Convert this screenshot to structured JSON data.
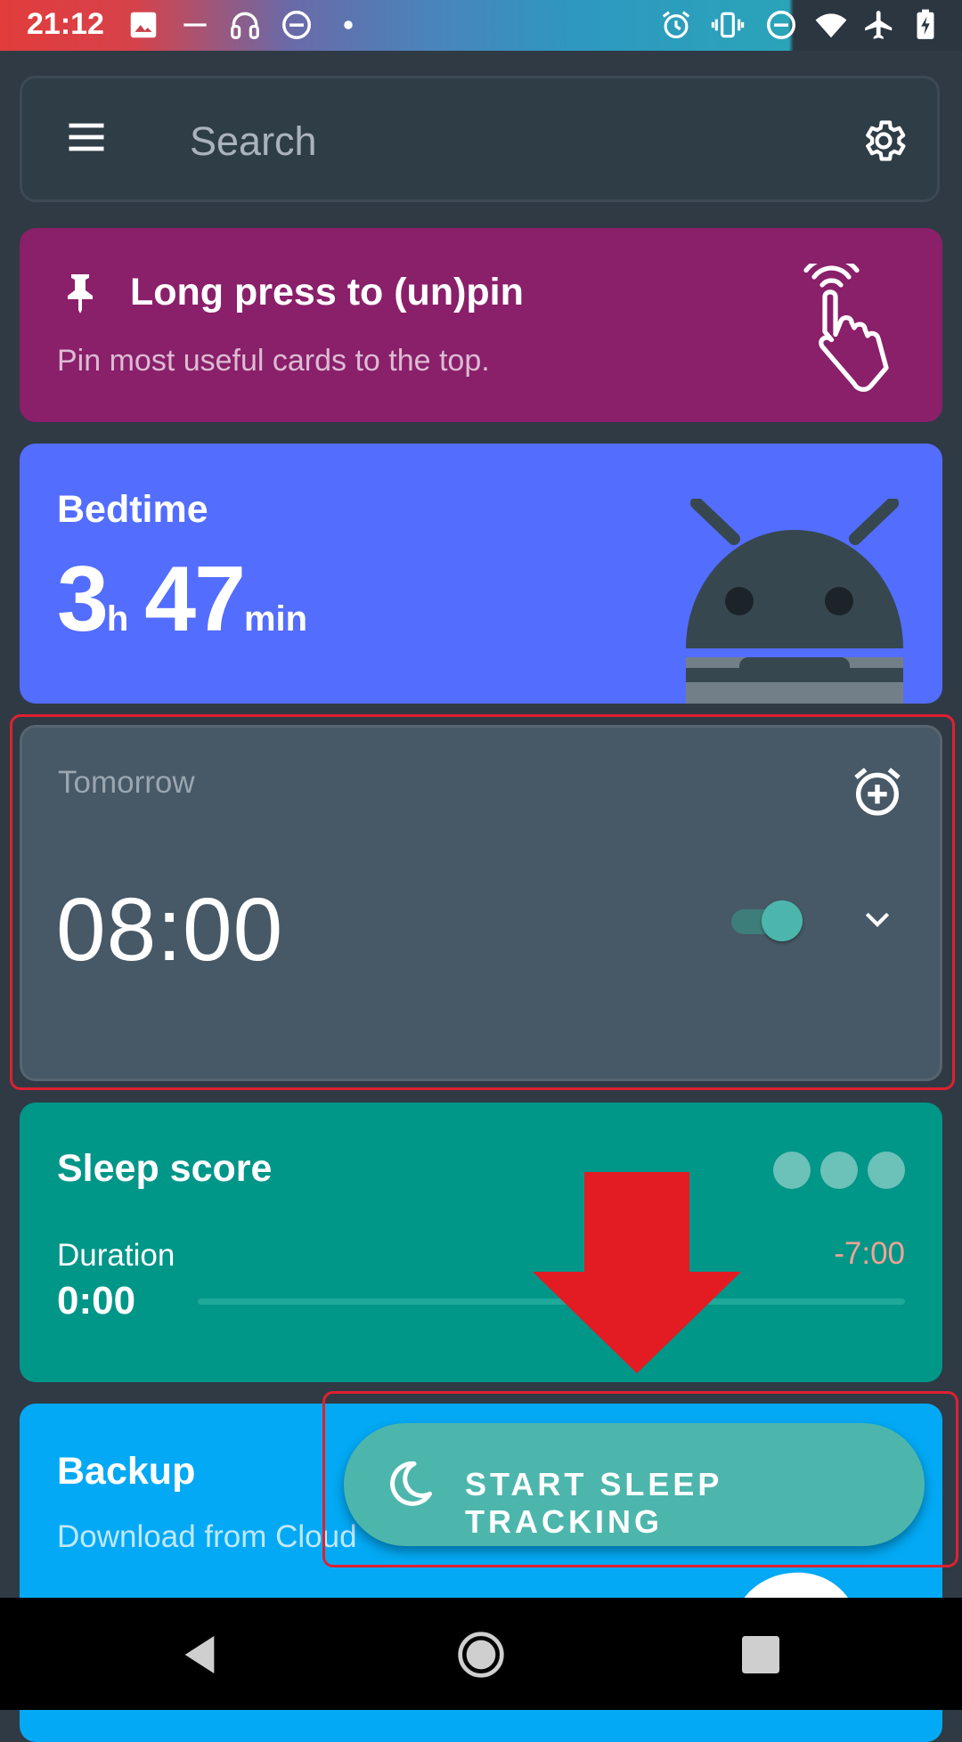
{
  "status_bar": {
    "time": "21:12",
    "left_icons": [
      "image-icon",
      "dash-icon",
      "headphones-icon",
      "dnd-icon",
      "dot-icon"
    ],
    "right_icons": [
      "alarm-icon",
      "vibrate-icon",
      "dnd-icon",
      "wifi-icon",
      "airplane-icon",
      "battery-charging-icon"
    ]
  },
  "search": {
    "placeholder": "Search",
    "menu_icon": "menu-icon",
    "settings_icon": "gear-icon"
  },
  "pin_card": {
    "title": "Long press to (un)pin",
    "subtitle": "Pin most useful cards to the top.",
    "icons": [
      "pin-icon",
      "touch-hand-icon"
    ],
    "color": "#8a1f6a"
  },
  "bedtime_card": {
    "label": "Bedtime",
    "hours": "3",
    "hours_unit": "h",
    "minutes": "47",
    "minutes_unit": "min",
    "color": "#536dfe"
  },
  "alarm_card": {
    "day": "Tomorrow",
    "time": "08:00",
    "enabled": true,
    "icons": [
      "add-alarm-icon",
      "chevron-down-icon"
    ]
  },
  "sleep_score_card": {
    "title": "Sleep score",
    "duration_label": "Duration",
    "duration_value": "0:00",
    "difference": "-7:00",
    "color": "#009688"
  },
  "backup_card": {
    "title": "Backup",
    "subtitle": "Download from Cloud",
    "color": "#03a9f4"
  },
  "fab": {
    "label": "START SLEEP TRACKING",
    "icon": "moon-icon",
    "color": "#4db6ac"
  },
  "annotation_color": "#e02030",
  "nav_bar": {
    "icons": [
      "back-icon",
      "home-icon",
      "recents-icon"
    ]
  }
}
